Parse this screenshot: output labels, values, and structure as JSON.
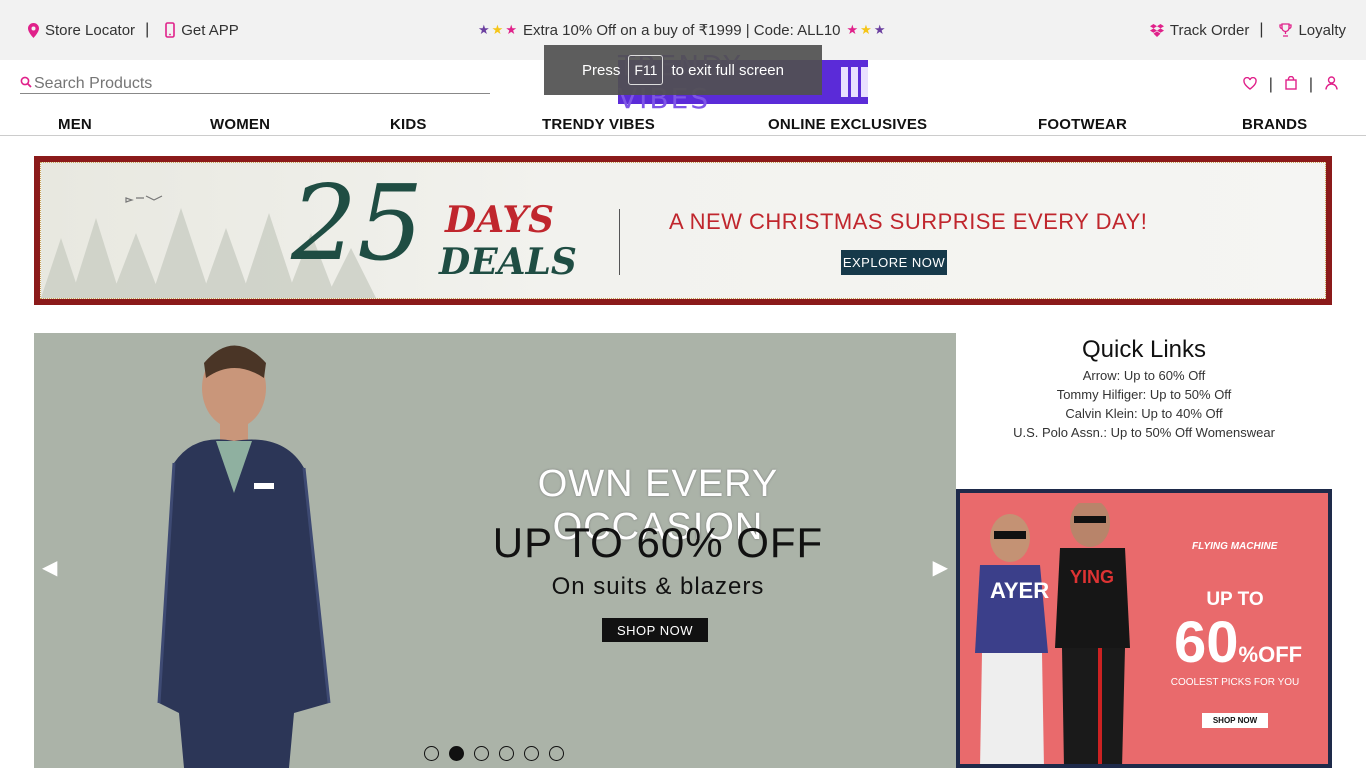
{
  "topbar": {
    "store_locator": "Store Locator",
    "get_app": "Get APP",
    "offer": "Extra 10% Off on a buy of ₹1999 | Code: ALL10",
    "track_order": "Track Order",
    "loyalty": "Loyalty",
    "separator": "|"
  },
  "search": {
    "placeholder": "Search Products"
  },
  "logo": {
    "text": "TRENDY VIBES"
  },
  "fullscreen_toast": {
    "press": "Press",
    "key": "F11",
    "rest": "to exit full screen"
  },
  "nav": {
    "items": [
      "MEN",
      "WOMEN",
      "KIDS",
      "TRENDY VIBES",
      "ONLINE EXCLUSIVES",
      "FOOTWEAR",
      "BRANDS"
    ]
  },
  "xmas_banner": {
    "number": "25",
    "days": "DAYS",
    "deals": "DEALS",
    "message": "A NEW CHRISTMAS SURPRISE EVERY DAY!",
    "button": "EXPLORE NOW",
    "colors": {
      "frame": "#8b1a1a",
      "green": "#1f4d43",
      "red": "#c0262d"
    }
  },
  "hero": {
    "line1": "OWN EVERY OCCASION",
    "line2": "UP TO 60% OFF",
    "line3": "On suits & blazers",
    "button": "SHOP NOW",
    "prev": "◀",
    "next": "▶",
    "slide_count": 6,
    "active_slide": 2
  },
  "quick_links": {
    "title": "Quick Links",
    "links": [
      "Arrow: Up to 60% Off",
      "Tommy Hilfiger: Up to 50% Off",
      "Calvin Klein: Up to 40% Off",
      "U.S. Polo Assn.: Up to 50% Off Womenswear"
    ]
  },
  "promo": {
    "brand": "FLYING MACHINE",
    "upto": "UP TO",
    "percent": "60",
    "pct_sign": "%",
    "off": "OFF",
    "tagline": "COOLEST PICKS FOR YOU",
    "button": "SHOP NOW"
  },
  "colors": {
    "accent": "#e0218a",
    "logo_bg": "#5b2bd8"
  }
}
